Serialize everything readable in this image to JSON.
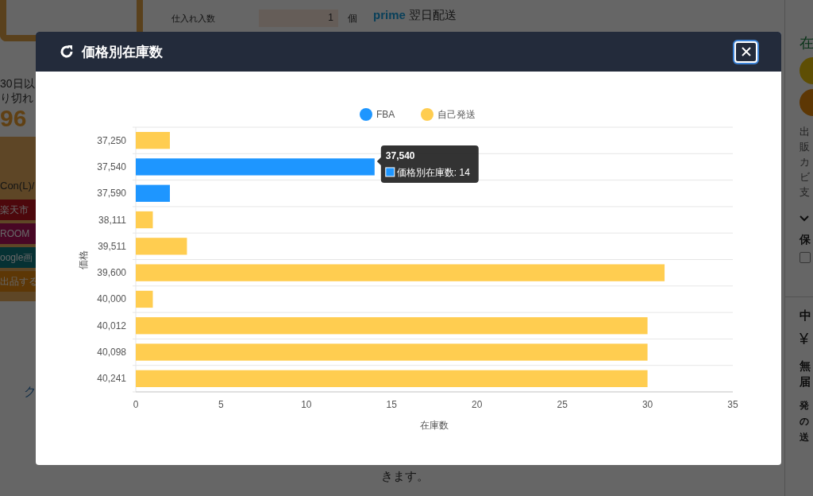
{
  "background": {
    "left_panel": {
      "lines": [
        "30日以",
        "り切れ"
      ],
      "rate": "96",
      "label": "Con(L)/",
      "links": [
        {
          "label": "楽天市",
          "kind": "market"
        },
        {
          "label": "ROOM",
          "kind": "room"
        },
        {
          "label": "oogle画",
          "kind": "image"
        },
        {
          "label": "出品する",
          "kind": "listing"
        }
      ],
      "footer_link": "ク"
    },
    "purchase_row": {
      "label": "仕入れ入数",
      "value": "1",
      "unit": "個"
    },
    "shipping": {
      "badge": "prime",
      "text": "翌日配送"
    },
    "description": [
      "きます。"
    ],
    "right_panel": {
      "stock": "在",
      "info": [
        "出",
        "販",
        "カ",
        "ビ",
        "支"
      ],
      "warranty": "保",
      "warranty_checked": false,
      "heading": "中",
      "price": "¥",
      "delivery": [
        "無",
        "届"
      ],
      "notes": [
        "発",
        "の",
        "送"
      ]
    }
  },
  "modal": {
    "title": "価格別在庫数",
    "chart_data": {
      "type": "bar",
      "orientation": "horizontal",
      "stacked": true,
      "legend": "top",
      "xlabel": "在庫数",
      "ylabel": "価格",
      "categories": [
        "37,250",
        "37,540",
        "37,590",
        "38,111",
        "39,511",
        "39,600",
        "40,000",
        "40,012",
        "40,098",
        "40,241"
      ],
      "series": [
        {
          "name": "FBA",
          "color": "#1e96ff",
          "values": [
            null,
            14,
            2,
            null,
            null,
            null,
            null,
            null,
            null,
            null
          ]
        },
        {
          "name": "自己発送",
          "color": "#ffcd50",
          "values": [
            2,
            null,
            null,
            1,
            3,
            31,
            1,
            30,
            30,
            30
          ]
        }
      ],
      "xlim": [
        0,
        35
      ],
      "xticks": [
        0,
        5,
        10,
        15,
        20,
        25,
        30,
        35
      ]
    },
    "tooltip": {
      "title": "37,540",
      "label": "価格別在庫数: 14"
    }
  }
}
